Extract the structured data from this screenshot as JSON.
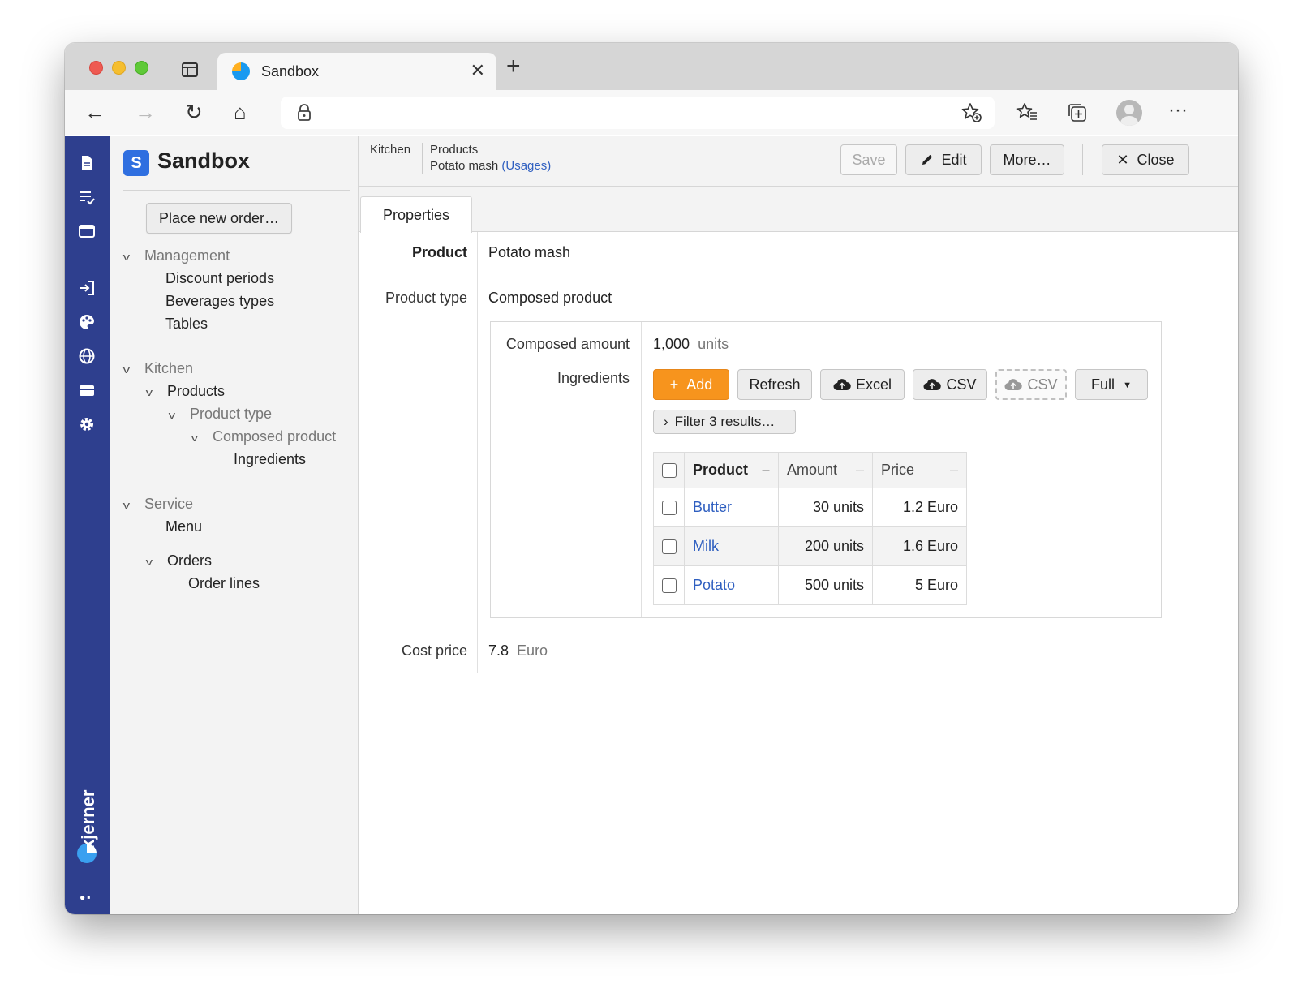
{
  "browser": {
    "tab_title": "Sandbox",
    "tab_close": "✕",
    "new_tab": "+"
  },
  "toolbar": {
    "back_icon": "←",
    "forward_icon": "→",
    "reload_icon": "↻",
    "home_icon": "⌂",
    "favorites_icon": "☆",
    "collections_icon": "⊞",
    "more_icon": "···"
  },
  "rail": {
    "icons": [
      "document-icon",
      "list-check-icon",
      "window-icon",
      "login-icon",
      "palette-icon",
      "globe-icon",
      "card-icon",
      "gear-icon"
    ],
    "logo_text": "kjerner"
  },
  "sidebar": {
    "brand_badge": "S",
    "brand_name": "Sandbox",
    "place_order": "Place new order…",
    "nav": {
      "management": "Management",
      "discount_periods": "Discount periods",
      "beverages_types": "Beverages types",
      "tables": "Tables",
      "kitchen": "Kitchen",
      "products": "Products",
      "product_type": "Product type",
      "composed_product": "Composed product",
      "ingredients": "Ingredients",
      "service": "Service",
      "menu": "Menu",
      "orders": "Orders",
      "order_lines": "Order lines"
    }
  },
  "header": {
    "breadcrumb_kitchen": "Kitchen",
    "breadcrumb_products": "Products",
    "breadcrumb_item": "Potato mash",
    "usages_link": "(Usages)",
    "save": "Save",
    "edit": "Edit",
    "more": "More…",
    "close": "Close"
  },
  "tabs": {
    "properties": "Properties"
  },
  "form": {
    "product_label": "Product",
    "product_value": "Potato mash",
    "product_type_label": "Product type",
    "product_type_value": "Composed product",
    "composed_amount_label": "Composed amount",
    "composed_amount_value": "1,000",
    "composed_amount_unit": "units",
    "ingredients_label": "Ingredients",
    "cost_price_label": "Cost price",
    "cost_price_value": "7.8",
    "cost_price_unit": "Euro"
  },
  "grid": {
    "add": "Add",
    "refresh": "Refresh",
    "excel": "Excel",
    "csv": "CSV",
    "csv_disabled": "CSV",
    "full": "Full",
    "filter": "Filter 3 results…",
    "columns": [
      "Product",
      "Amount",
      "Price"
    ],
    "rows": [
      {
        "product": "Butter",
        "amount": "30 units",
        "price": "1.2 Euro"
      },
      {
        "product": "Milk",
        "amount": "200 units",
        "price": "1.6 Euro"
      },
      {
        "product": "Potato",
        "amount": "500 units",
        "price": "5 Euro"
      }
    ]
  },
  "colors": {
    "rail": "#2e3f8e",
    "accent_orange": "#f7941d",
    "link": "#2f5fc0"
  }
}
